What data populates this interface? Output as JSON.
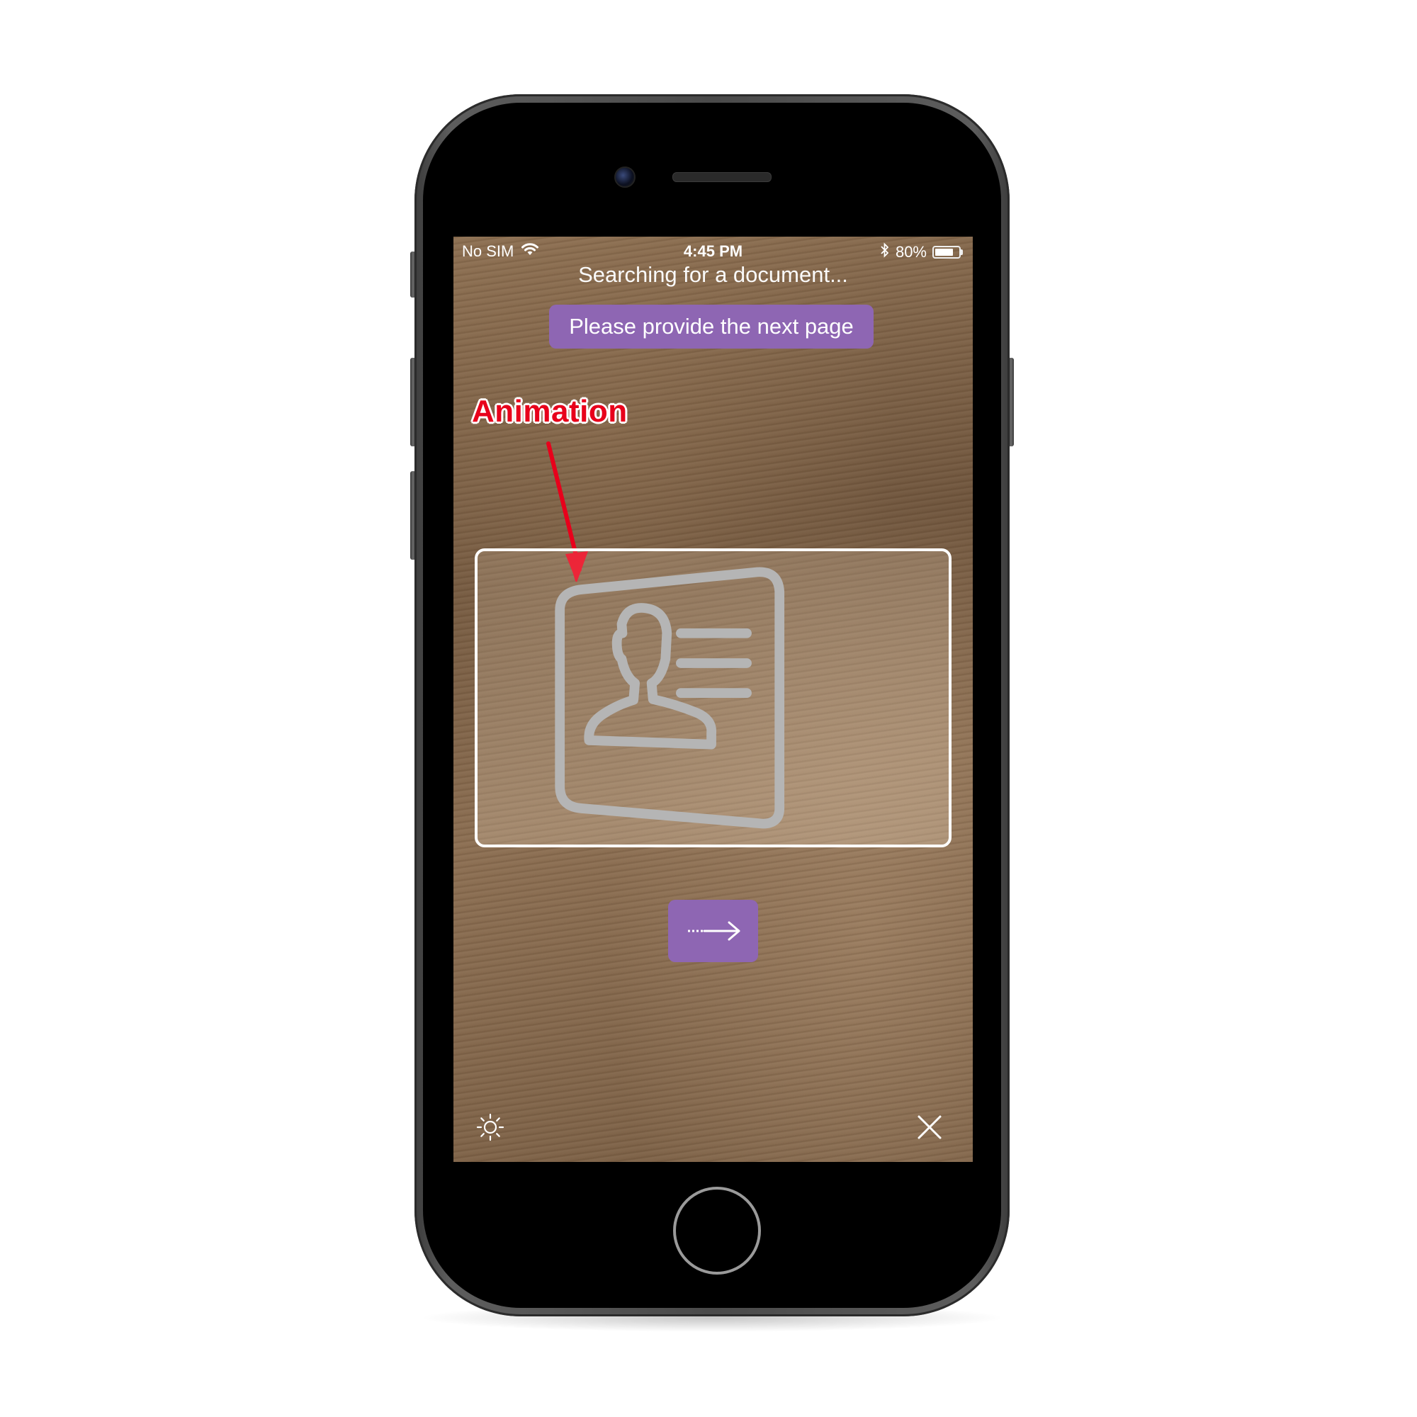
{
  "status_bar": {
    "carrier": "No SIM",
    "time": "4:45 PM",
    "battery": "80%",
    "battery_level": 0.8
  },
  "scanner": {
    "heading": "Searching for a document...",
    "prompt": "Please provide the next page"
  },
  "annotation": {
    "label": "Animation",
    "color": "#e8001b"
  },
  "icons": {
    "wifi": "wifi-icon",
    "bluetooth": "bluetooth-icon",
    "battery": "battery-icon",
    "id_card": "id-card-icon",
    "next": "dotted-arrow-right-icon",
    "flash": "sun-icon",
    "close": "close-icon"
  },
  "colors": {
    "accent": "#8e66b3",
    "frame": "#ffffff",
    "id_card_outline": "#b5b5b5"
  }
}
